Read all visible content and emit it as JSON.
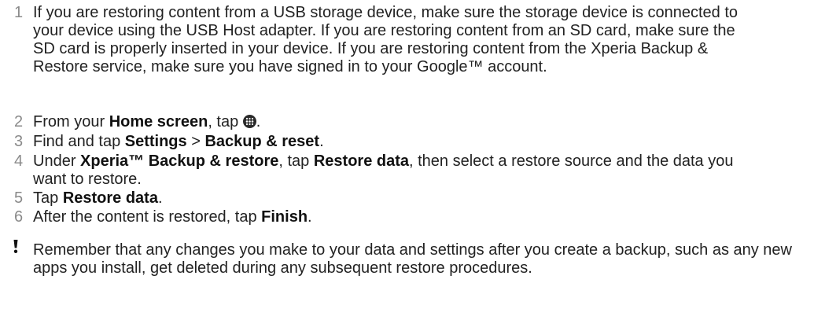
{
  "steps": [
    {
      "num": "1",
      "text": "If you are restoring content from a USB storage device, make sure the storage device is connected to your device using the USB Host adapter. If you are restoring content from an SD card, make sure the SD card is properly inserted in your device. If you are restoring content from the Xperia Backup & Restore service, make sure you have signed in to your Google™ account."
    },
    {
      "num": "2",
      "before": "From your ",
      "bold": "Home screen",
      "after": ", tap ",
      "end": ".",
      "icon": "apps-grid-icon"
    },
    {
      "num": "3",
      "before": "Find and tap ",
      "bold1": "Settings",
      "mid": " > ",
      "bold2": "Backup & reset",
      "end": "."
    },
    {
      "num": "4",
      "before": "Under ",
      "bold1": "Xperia™ Backup & restore",
      "mid": ", tap ",
      "bold2": "Restore data",
      "after": ", then select a restore source and the data you want to restore."
    },
    {
      "num": "5",
      "before": "Tap ",
      "bold": "Restore data",
      "end": "."
    },
    {
      "num": "6",
      "before": "After the content is restored, tap ",
      "bold": "Finish",
      "end": "."
    }
  ],
  "note": {
    "icon": "exclamation-icon",
    "text": "Remember that any changes you make to your data and settings after you create a backup, such as any new apps you install, get deleted during any subsequent restore procedures."
  }
}
